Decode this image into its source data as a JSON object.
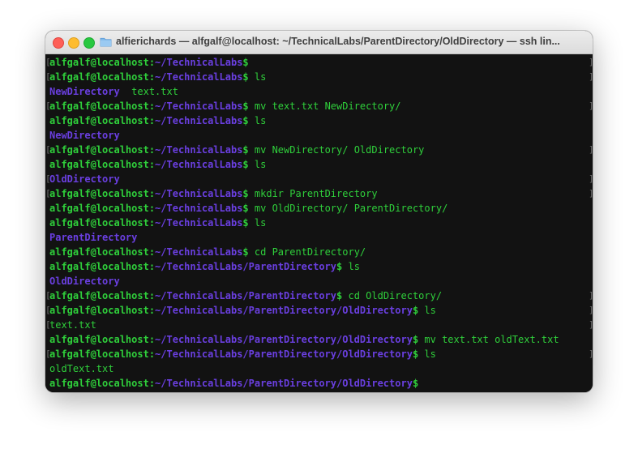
{
  "window": {
    "title": "alfierichards — alfgalf@localhost: ~/TechnicalLabs/ParentDirectory/OldDirectory — ssh lin..."
  },
  "colors": {
    "prompt_user": "#2fcf3b",
    "prompt_path": "#6a3fe0",
    "directory_output": "#6a3fe0",
    "file_output": "#2fcf3b",
    "background": "#121212"
  },
  "terminal": {
    "lines": [
      {
        "type": "prompt",
        "user": "alfgalf@localhost:",
        "path": "~/TechnicalLabs",
        "cmd": "",
        "gl": "[",
        "gr": "]"
      },
      {
        "type": "prompt",
        "user": "alfgalf@localhost:",
        "path": "~/TechnicalLabs",
        "cmd": "ls",
        "gl": "[",
        "gr": "]"
      },
      {
        "type": "output",
        "parts": [
          {
            "text": "NewDirectory",
            "kind": "dir"
          },
          {
            "text": "  text.txt",
            "kind": "file"
          }
        ],
        "gl": "",
        "gr": ""
      },
      {
        "type": "prompt",
        "user": "alfgalf@localhost:",
        "path": "~/TechnicalLabs",
        "cmd": "mv text.txt NewDirectory/",
        "gl": "[",
        "gr": "]"
      },
      {
        "type": "prompt",
        "user": "alfgalf@localhost:",
        "path": "~/TechnicalLabs",
        "cmd": "ls",
        "gl": "",
        "gr": ""
      },
      {
        "type": "output",
        "parts": [
          {
            "text": "NewDirectory",
            "kind": "dir"
          }
        ],
        "gl": "",
        "gr": ""
      },
      {
        "type": "prompt",
        "user": "alfgalf@localhost:",
        "path": "~/TechnicalLabs",
        "cmd": "mv NewDirectory/ OldDirectory",
        "gl": "[",
        "gr": "]"
      },
      {
        "type": "prompt",
        "user": "alfgalf@localhost:",
        "path": "~/TechnicalLabs",
        "cmd": "ls",
        "gl": "",
        "gr": ""
      },
      {
        "type": "output",
        "parts": [
          {
            "text": "OldDirectory",
            "kind": "dir"
          }
        ],
        "gl": "[",
        "gr": "]"
      },
      {
        "type": "prompt",
        "user": "alfgalf@localhost:",
        "path": "~/TechnicalLabs",
        "cmd": "mkdir ParentDirectory",
        "gl": "[",
        "gr": "]"
      },
      {
        "type": "prompt",
        "user": "alfgalf@localhost:",
        "path": "~/TechnicalLabs",
        "cmd": "mv OldDirectory/ ParentDirectory/",
        "gl": "",
        "gr": ""
      },
      {
        "type": "prompt",
        "user": "alfgalf@localhost:",
        "path": "~/TechnicalLabs",
        "cmd": "ls",
        "gl": "",
        "gr": ""
      },
      {
        "type": "output",
        "parts": [
          {
            "text": "ParentDirectory",
            "kind": "dir"
          }
        ],
        "gl": "",
        "gr": ""
      },
      {
        "type": "prompt",
        "user": "alfgalf@localhost:",
        "path": "~/TechnicalLabs",
        "cmd": "cd ParentDirectory/",
        "gl": "",
        "gr": ""
      },
      {
        "type": "prompt",
        "user": "alfgalf@localhost:",
        "path": "~/TechnicalLabs/ParentDirectory",
        "cmd": "ls",
        "gl": "",
        "gr": ""
      },
      {
        "type": "output",
        "parts": [
          {
            "text": "OldDirectory",
            "kind": "dir"
          }
        ],
        "gl": "",
        "gr": ""
      },
      {
        "type": "prompt",
        "user": "alfgalf@localhost:",
        "path": "~/TechnicalLabs/ParentDirectory",
        "cmd": "cd OldDirectory/",
        "gl": "[",
        "gr": "]"
      },
      {
        "type": "prompt",
        "user": "alfgalf@localhost:",
        "path": "~/TechnicalLabs/ParentDirectory/OldDirectory",
        "cmd": "ls",
        "gl": "[",
        "gr": "]"
      },
      {
        "type": "output",
        "parts": [
          {
            "text": "text.txt",
            "kind": "file"
          }
        ],
        "gl": "[",
        "gr": "]"
      },
      {
        "type": "prompt",
        "user": "alfgalf@localhost:",
        "path": "~/TechnicalLabs/ParentDirectory/OldDirectory",
        "cmd": "mv text.txt oldText.txt",
        "gl": "",
        "gr": ""
      },
      {
        "type": "prompt",
        "user": "alfgalf@localhost:",
        "path": "~/TechnicalLabs/ParentDirectory/OldDirectory",
        "cmd": "ls",
        "gl": "[",
        "gr": "]"
      },
      {
        "type": "output",
        "parts": [
          {
            "text": "oldText.txt",
            "kind": "file"
          }
        ],
        "gl": "",
        "gr": ""
      },
      {
        "type": "prompt",
        "user": "alfgalf@localhost:",
        "path": "~/TechnicalLabs/ParentDirectory/OldDirectory",
        "cmd": "",
        "gl": "",
        "gr": ""
      }
    ]
  }
}
